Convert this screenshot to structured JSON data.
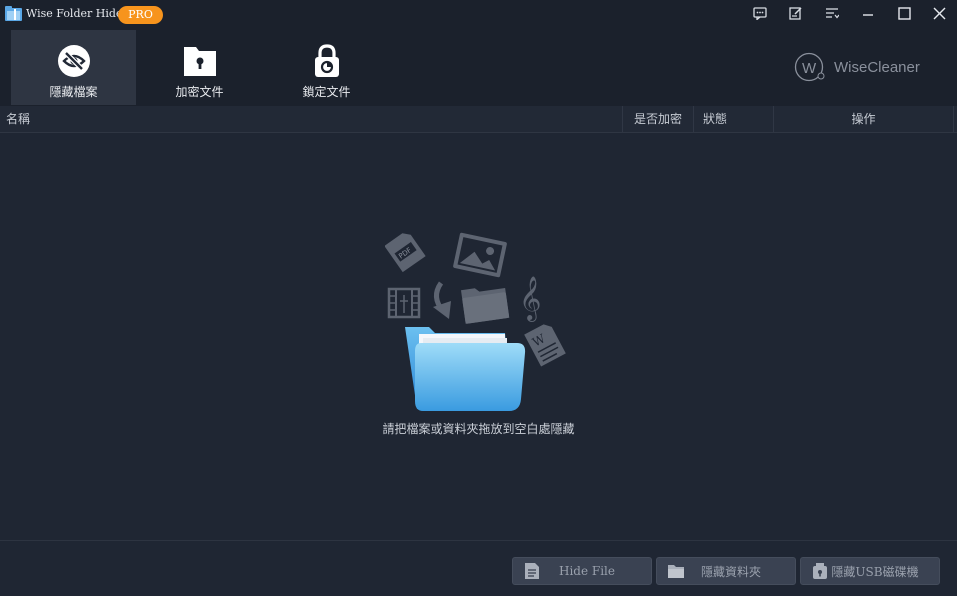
{
  "app": {
    "title": "Wise Folder Hider",
    "badge": "PRO"
  },
  "window_controls": [
    "feedback-icon",
    "edit-note-icon",
    "menu-icon",
    "minimize-icon",
    "maximize-icon",
    "close-icon"
  ],
  "toolbar": {
    "items": [
      {
        "label": "隱藏檔案",
        "icon": "eye-slash-icon",
        "active": true
      },
      {
        "label": "加密文件",
        "icon": "locked-file-icon",
        "active": false
      },
      {
        "label": "鎖定文件",
        "icon": "padlock-icon",
        "active": false
      }
    ],
    "brand": "WiseCleaner"
  },
  "table": {
    "columns": [
      "名稱",
      "是否加密",
      "狀態",
      "操作"
    ]
  },
  "empty_state": {
    "hint": "請把檔案或資料夾拖放到空白處隱藏"
  },
  "footer": {
    "buttons": [
      {
        "label": "Hide File",
        "icon": "file-icon"
      },
      {
        "label": "隱藏資料夾",
        "icon": "folder-icon"
      },
      {
        "label": "隱藏USB磁碟機",
        "icon": "usb-lock-icon"
      }
    ]
  },
  "colors": {
    "accent": "#f7941d",
    "background": "#1f2633",
    "folder_blue": "#3a9be0"
  }
}
